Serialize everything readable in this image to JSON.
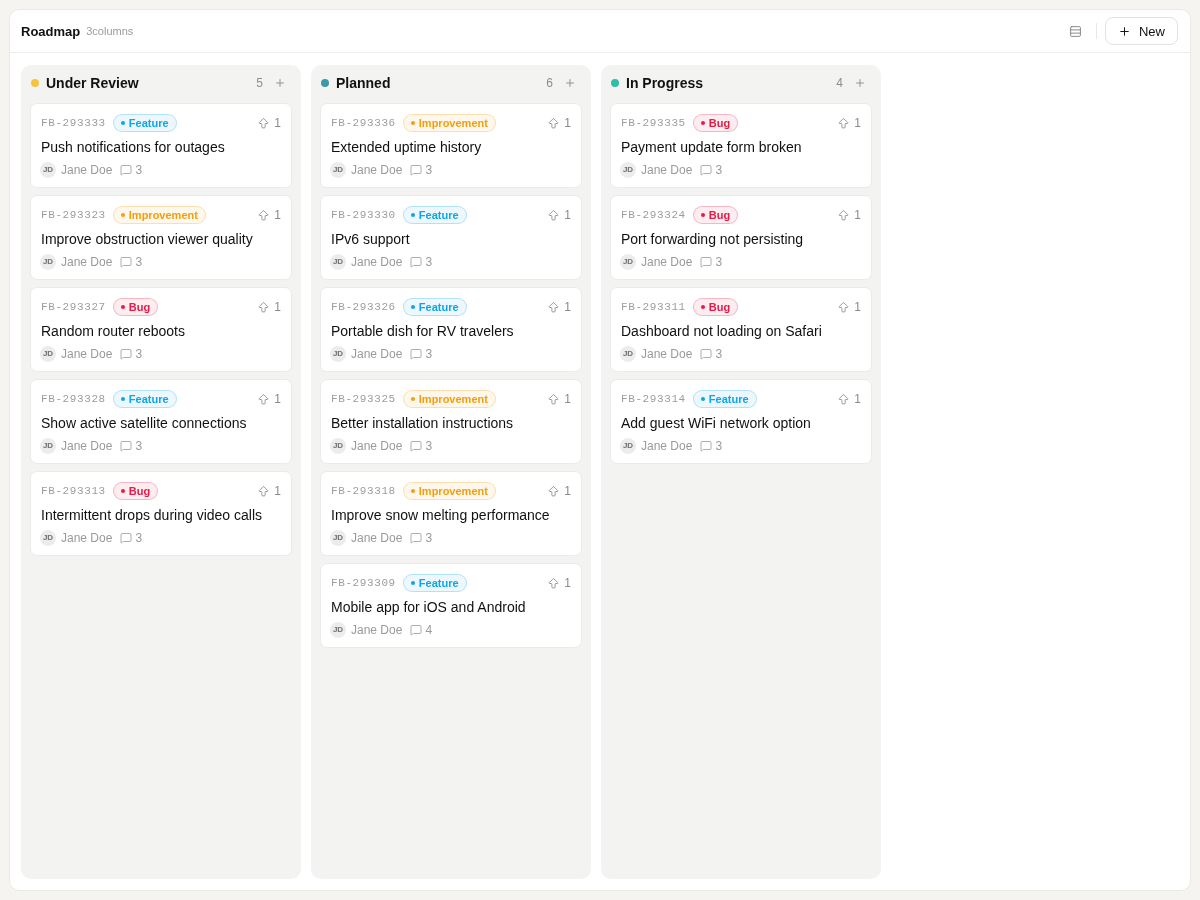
{
  "header": {
    "title": "Roadmap",
    "subtitle": "3columns",
    "new_button": "New"
  },
  "columns": [
    {
      "title": "Under Review",
      "color": "#f5c542",
      "count": "5",
      "cards": [
        {
          "id": "FB-293333",
          "tag": {
            "label": "Feature",
            "color": "#0ea5e9"
          },
          "title": "Push notifications for outages",
          "avatar_initials": "JD",
          "author": "Jane Doe",
          "comments": "3",
          "votes": "1"
        },
        {
          "id": "FB-293323",
          "tag": {
            "label": "Improvement",
            "color": "#f59e0b"
          },
          "title": "Improve obstruction viewer quality",
          "avatar_initials": "JD",
          "author": "Jane Doe",
          "comments": "3",
          "votes": "1"
        },
        {
          "id": "FB-293327",
          "tag": {
            "label": "Bug",
            "color": "#e11d48"
          },
          "title": "Random router reboots",
          "avatar_initials": "JD",
          "author": "Jane Doe",
          "comments": "3",
          "votes": "1"
        },
        {
          "id": "FB-293328",
          "tag": {
            "label": "Feature",
            "color": "#0ea5e9"
          },
          "title": "Show active satellite connections",
          "avatar_initials": "JD",
          "author": "Jane Doe",
          "comments": "3",
          "votes": "1"
        },
        {
          "id": "FB-293313",
          "tag": {
            "label": "Bug",
            "color": "#e11d48"
          },
          "title": "Intermittent drops during video calls",
          "avatar_initials": "JD",
          "author": "Jane Doe",
          "comments": "3",
          "votes": "1"
        }
      ]
    },
    {
      "title": "Planned",
      "color": "#3a9ba6",
      "count": "6",
      "cards": [
        {
          "id": "FB-293336",
          "tag": {
            "label": "Improvement",
            "color": "#f59e0b"
          },
          "title": "Extended uptime history",
          "avatar_initials": "JD",
          "author": "Jane Doe",
          "comments": "3",
          "votes": "1"
        },
        {
          "id": "FB-293330",
          "tag": {
            "label": "Feature",
            "color": "#0ea5e9"
          },
          "title": "IPv6 support",
          "avatar_initials": "JD",
          "author": "Jane Doe",
          "comments": "3",
          "votes": "1"
        },
        {
          "id": "FB-293326",
          "tag": {
            "label": "Feature",
            "color": "#0ea5e9"
          },
          "title": "Portable dish for RV travelers",
          "avatar_initials": "JD",
          "author": "Jane Doe",
          "comments": "3",
          "votes": "1"
        },
        {
          "id": "FB-293325",
          "tag": {
            "label": "Improvement",
            "color": "#f59e0b"
          },
          "title": "Better installation instructions",
          "avatar_initials": "JD",
          "author": "Jane Doe",
          "comments": "3",
          "votes": "1"
        },
        {
          "id": "FB-293318",
          "tag": {
            "label": "Improvement",
            "color": "#f59e0b"
          },
          "title": "Improve snow melting performance",
          "avatar_initials": "JD",
          "author": "Jane Doe",
          "comments": "3",
          "votes": "1"
        },
        {
          "id": "FB-293309",
          "tag": {
            "label": "Feature",
            "color": "#0ea5e9"
          },
          "title": "Mobile app for iOS and Android",
          "avatar_initials": "JD",
          "author": "Jane Doe",
          "comments": "4",
          "votes": "1"
        }
      ]
    },
    {
      "title": "In Progress",
      "color": "#2ebfa8",
      "count": "4",
      "cards": [
        {
          "id": "FB-293335",
          "tag": {
            "label": "Bug",
            "color": "#e11d48"
          },
          "title": "Payment update form broken",
          "avatar_initials": "JD",
          "author": "Jane Doe",
          "comments": "3",
          "votes": "1"
        },
        {
          "id": "FB-293324",
          "tag": {
            "label": "Bug",
            "color": "#e11d48"
          },
          "title": "Port forwarding not persisting",
          "avatar_initials": "JD",
          "author": "Jane Doe",
          "comments": "3",
          "votes": "1"
        },
        {
          "id": "FB-293311",
          "tag": {
            "label": "Bug",
            "color": "#e11d48"
          },
          "title": "Dashboard not loading on Safari",
          "avatar_initials": "JD",
          "author": "Jane Doe",
          "comments": "3",
          "votes": "1"
        },
        {
          "id": "FB-293314",
          "tag": {
            "label": "Feature",
            "color": "#0ea5e9"
          },
          "title": "Add guest WiFi network option",
          "avatar_initials": "JD",
          "author": "Jane Doe",
          "comments": "3",
          "votes": "1"
        }
      ]
    }
  ]
}
